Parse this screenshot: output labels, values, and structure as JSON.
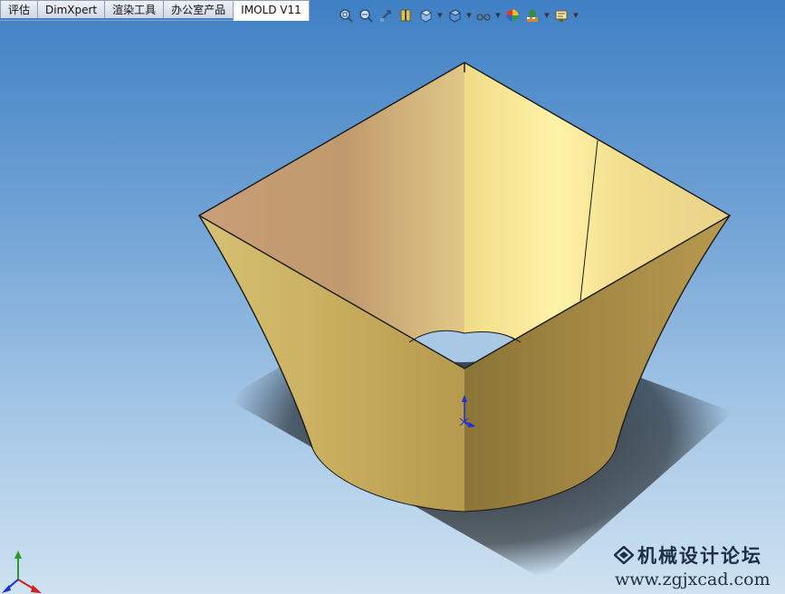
{
  "tabs": [
    {
      "label": "评估"
    },
    {
      "label": "DimXpert"
    },
    {
      "label": "渲染工具"
    },
    {
      "label": "办公室产品"
    },
    {
      "label": "IMOLD V11"
    }
  ],
  "toolbar": {
    "icons": [
      "zoom-to-fit-icon",
      "zoom-to-area-icon",
      "previous-view-icon",
      "section-view-icon",
      "view-orientation-icon",
      "display-style-icon",
      "hide-show-items-icon",
      "edit-appearance-icon",
      "apply-scene-icon",
      "view-settings-icon"
    ]
  },
  "watermark": {
    "line1": "机械设计论坛",
    "line2": "www.zgjxcad.com"
  },
  "colors": {
    "background_top": "#3f80c4",
    "background_bottom": "#cfe2f1",
    "part_gold": "#c8ab5e",
    "part_inner_pink": "#c79a74"
  }
}
